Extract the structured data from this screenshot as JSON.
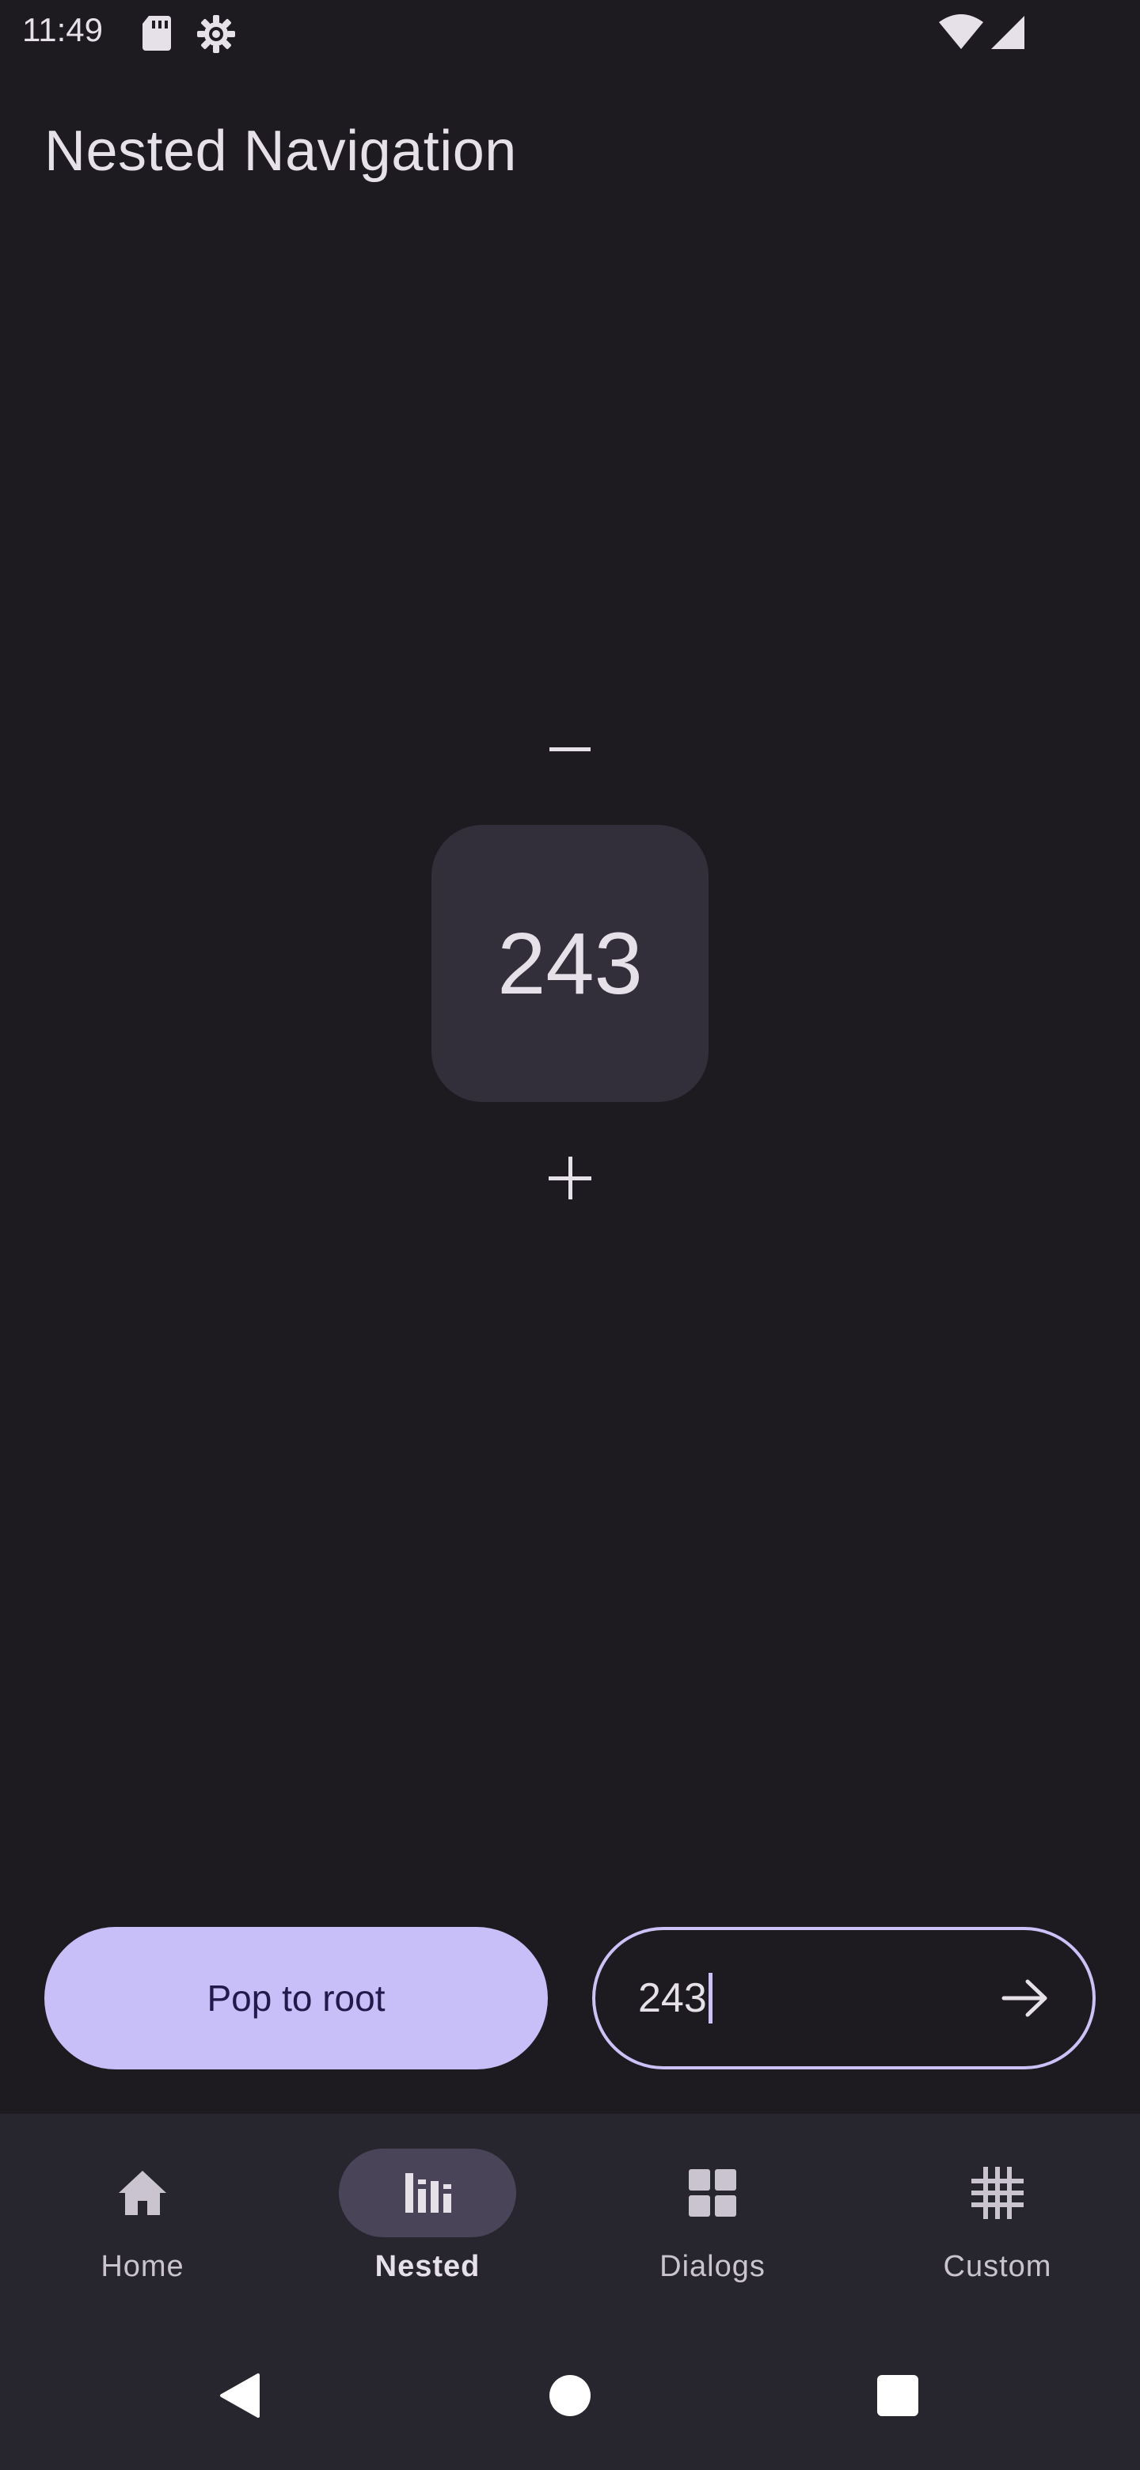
{
  "status_bar": {
    "time": "11:49",
    "icons": [
      "sd-card-icon",
      "settings-gear-icon",
      "wifi-icon",
      "cellular-signal-icon"
    ]
  },
  "page": {
    "title": "Nested Navigation"
  },
  "counter": {
    "value": "243",
    "decrement_icon": "minus-icon",
    "increment_icon": "plus-icon"
  },
  "actions": {
    "pop_label": "Pop to root",
    "input_value": "243",
    "go_icon": "arrow-right-icon"
  },
  "bottom_nav": {
    "items": [
      {
        "label": "Home",
        "icon": "home-icon",
        "active": false
      },
      {
        "label": "Nested",
        "icon": "bar-chart-icon",
        "active": true
      },
      {
        "label": "Dialogs",
        "icon": "dashboard-grid-icon",
        "active": false
      },
      {
        "label": "Custom",
        "icon": "hashtag-grid-icon",
        "active": false
      }
    ]
  },
  "system_nav": {
    "icons": [
      "back-icon",
      "home-circle-icon",
      "recents-square-icon"
    ]
  },
  "colors": {
    "background": "#1d1b20",
    "surface_container": "#27252d",
    "counter_box": "#322f3b",
    "primary_container": "#c8bff9",
    "outline_accent": "#cbc2f7",
    "active_indicator": "#4a4458",
    "on_surface": "#e6e0e9"
  }
}
